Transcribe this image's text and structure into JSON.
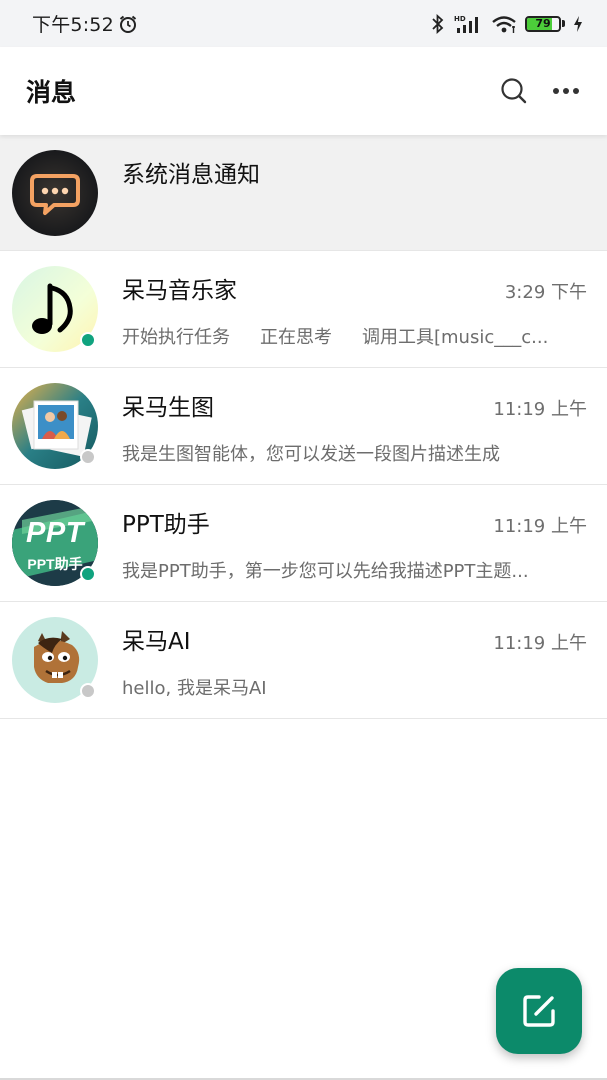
{
  "status_bar": {
    "time": "下午5:52",
    "battery_level": "79",
    "battery_fraction": 0.79,
    "icons": [
      "alarm-icon",
      "bluetooth-icon",
      "hd-signal-icon",
      "wifi-icon",
      "battery-icon",
      "charging-icon"
    ]
  },
  "header": {
    "title": "消息",
    "icons": [
      "search-icon",
      "more-icon"
    ]
  },
  "conversations": [
    {
      "name": "系统消息通知",
      "time": "",
      "preview": "",
      "avatar": "chat-bubble-avatar",
      "pinned": true
    },
    {
      "name": "呆马音乐家",
      "time": "3:29 下午",
      "preview_segments": [
        "开始执行任务",
        "正在思考",
        "调用工具[music___c..."
      ],
      "avatar": "music-note-avatar",
      "presence": "online",
      "presence_color": "#10a37f"
    },
    {
      "name": "呆马生图",
      "time": "11:19 上午",
      "preview": "我是生图智能体，您可以发送一段图片描述生成",
      "avatar": "photos-avatar",
      "presence": "offline",
      "presence_color": "#c8c8c8"
    },
    {
      "name": "PPT助手",
      "time": "11:19 上午",
      "preview": "我是PPT助手，第一步您可以先给我描述PPT主题...",
      "avatar": "ppt-avatar",
      "avatar_text_big": "PPT",
      "avatar_text_small": "PPT助手",
      "presence": "online",
      "presence_color": "#10a37f"
    },
    {
      "name": "呆马AI",
      "time": "11:19 上午",
      "preview": "hello, 我是呆马AI",
      "avatar": "horse-avatar",
      "presence": "offline",
      "presence_color": "#c8c8c8"
    }
  ],
  "fab": {
    "icon": "compose-icon",
    "color": "#0c8a6a"
  }
}
